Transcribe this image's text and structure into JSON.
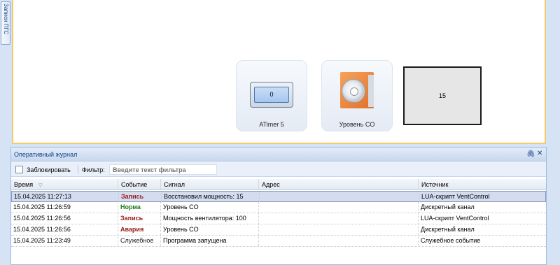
{
  "side_tab": {
    "label": "Записи ПГС"
  },
  "canvas": {
    "widgets": [
      {
        "label": "ATimer 5",
        "value": "0"
      },
      {
        "label": "Уровень CO"
      }
    ],
    "value_box": {
      "value": "15"
    }
  },
  "journal": {
    "title": "Оперативный журнал",
    "pin_icon": "pin-icon",
    "close_icon": "close-icon",
    "lock_label": "Заблокировать",
    "filter_label": "Фильтр:",
    "filter_placeholder": "Введите текст фильтра",
    "columns": [
      "Время",
      "Событие",
      "Сигнал",
      "Адрес",
      "Источник"
    ],
    "rows": [
      {
        "time": "15.04.2025 11:27:13",
        "event": "Запись",
        "signal": "Восстановил мощность: 15",
        "address": "",
        "source": "LUA-скрипт VentControl"
      },
      {
        "time": "15.04.2025 11:26:59",
        "event": "Норма",
        "signal": "Уровень CO",
        "address": "",
        "source": "Дискретный канал"
      },
      {
        "time": "15.04.2025 11:26:56",
        "event": "Запись",
        "signal": "Мощность вентилятора: 100",
        "address": "",
        "source": "LUA-скрипт VentControl"
      },
      {
        "time": "15.04.2025 11:26:56",
        "event": "Авария",
        "signal": "Уровень CO",
        "address": "",
        "source": "Дискретный канал"
      },
      {
        "time": "15.04.2025 11:23:49",
        "event": "Служебное",
        "signal": "Программа запущена",
        "address": "",
        "source": "Служебное событие"
      }
    ]
  },
  "colors": {
    "event_record": "#9b1c1c",
    "event_norm": "#1e7a1e",
    "event_alarm": "#9b1c1c",
    "canvas_border": "#f3c96a",
    "panel_header": "#15428b"
  }
}
